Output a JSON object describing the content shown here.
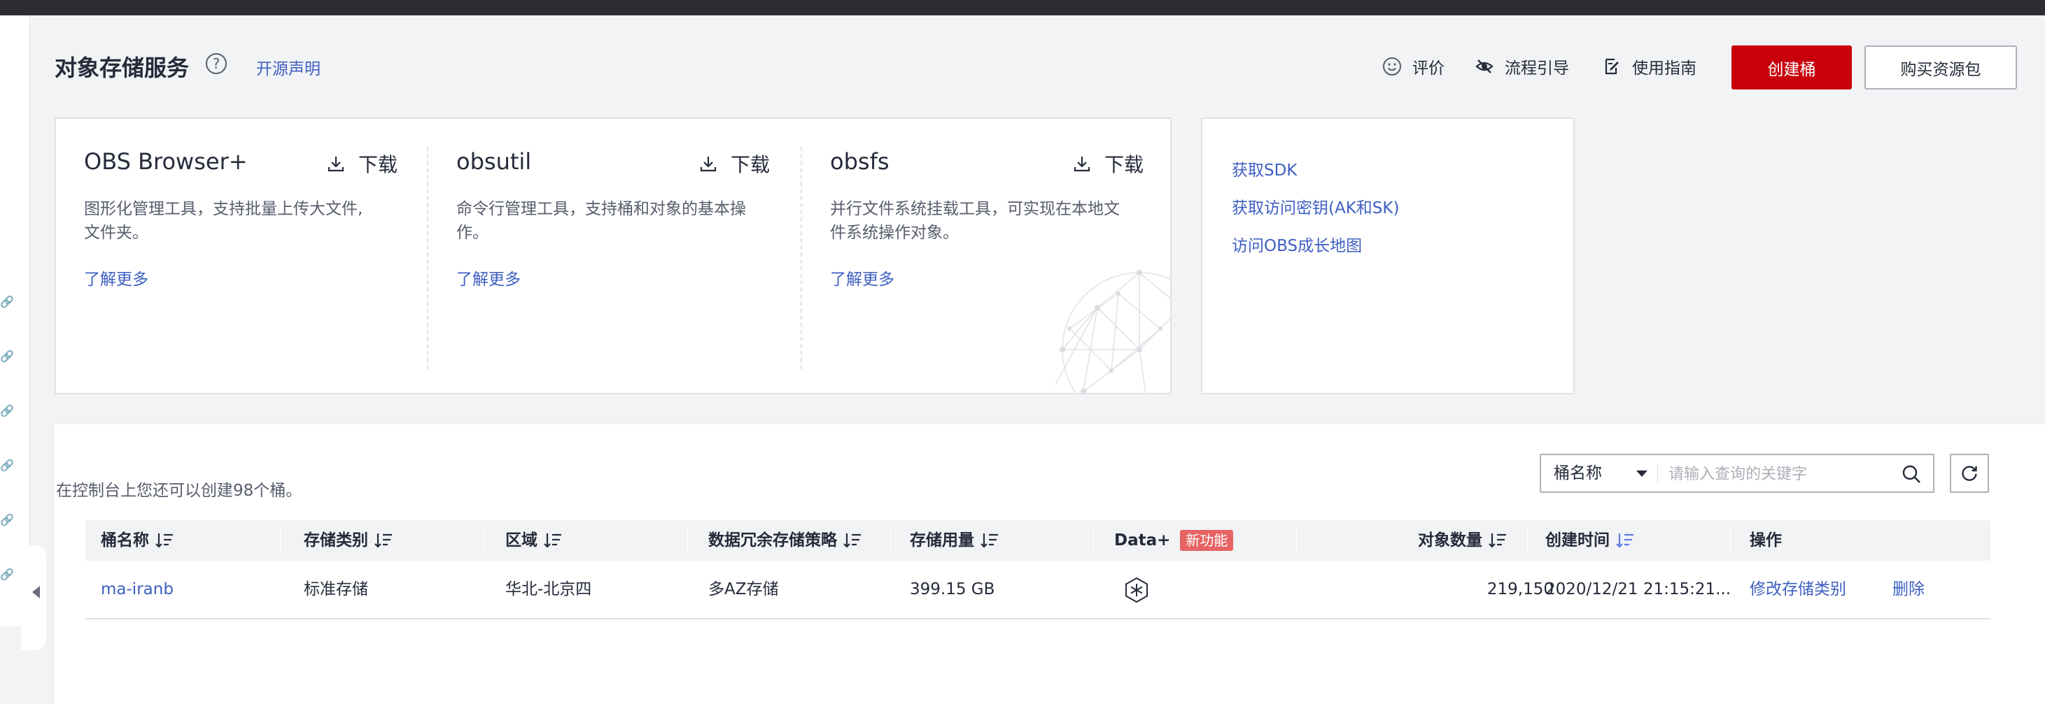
{
  "header": {
    "title": "对象存储服务",
    "open_source_link": "开源声明",
    "feedback": "评价",
    "guide": "流程引导",
    "manual": "使用指南",
    "create_bucket": "创建桶",
    "buy_package": "购买资源包"
  },
  "tools": [
    {
      "name": "OBS Browser+",
      "download": "下载",
      "desc_line1": "图形化管理工具，支持批量上传大文件,",
      "desc_line2": "文件夹。",
      "more": "了解更多"
    },
    {
      "name": "obsutil",
      "download": "下载",
      "desc_line1": "命令行管理工具，支持桶和对象的基本操",
      "desc_line2": "作。",
      "more": "了解更多"
    },
    {
      "name": "obsfs",
      "download": "下载",
      "desc_line1": "并行文件系统挂载工具，可实现在本地文",
      "desc_line2": "件系统操作对象。",
      "more": "了解更多"
    }
  ],
  "quick_links": [
    "获取SDK",
    "获取访问密钥(AK和SK)",
    "访问OBS成长地图"
  ],
  "buckets": {
    "quota_text": "在控制台上您还可以创建98个桶。",
    "search": {
      "field": "桶名称",
      "placeholder": "请输入查询的关键字"
    },
    "columns": [
      "桶名称",
      "存储类别",
      "区域",
      "数据冗余存储策略",
      "存储用量",
      "Data+",
      "对象数量",
      "创建时间",
      "操作"
    ],
    "new_feature_badge": "新功能",
    "rows": [
      {
        "name": "ma-iranb",
        "storage_class": "标准存储",
        "region": "华北-北京四",
        "redundancy": "多AZ存储",
        "usage": "399.15 GB",
        "objects": "219,150",
        "created": "2020/12/21 21:15:21...",
        "action_modify": "修改存储类别",
        "action_delete": "删除"
      }
    ]
  },
  "colors": {
    "primary": "#c7000b",
    "link": "#3e5fc1",
    "badge": "#e66464"
  }
}
